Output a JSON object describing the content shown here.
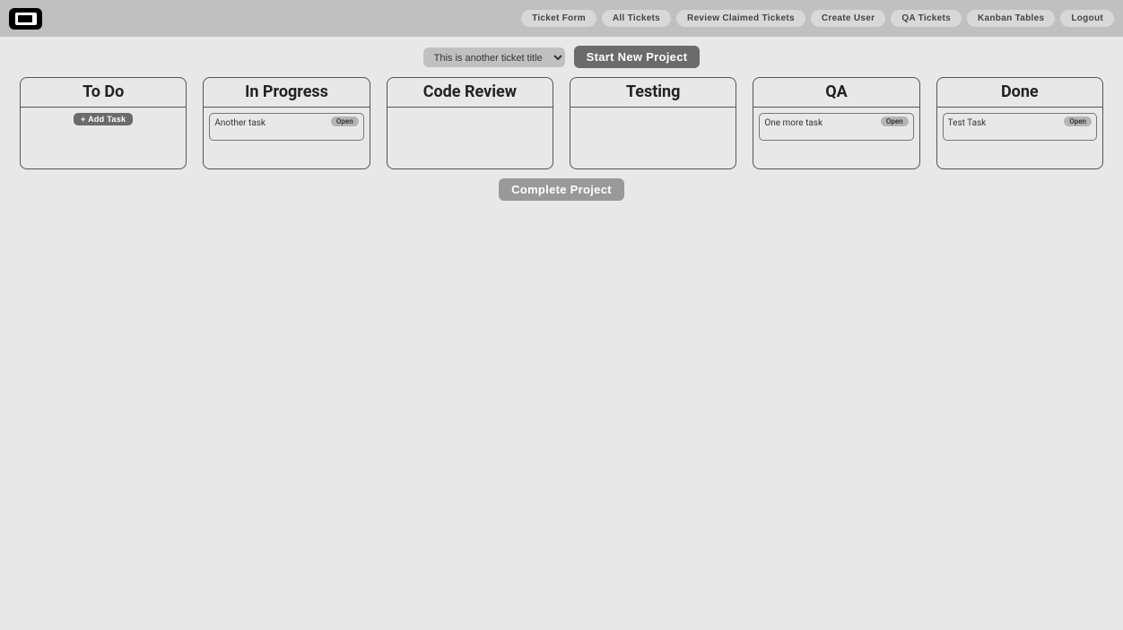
{
  "header": {
    "nav": [
      "Ticket Form",
      "All Tickets",
      "Review Claimed Tickets",
      "Create User",
      "QA Tickets",
      "Kanban Tables",
      "Logout"
    ]
  },
  "toolbar": {
    "project_selected": "This is another ticket title",
    "start_label": "Start New Project"
  },
  "columns": {
    "todo": {
      "title": "To Do",
      "add_label": "+ Add Task"
    },
    "in_progress": {
      "title": "In Progress",
      "cards": [
        {
          "title": "Another task",
          "badge": "Open"
        }
      ]
    },
    "code_review": {
      "title": "Code Review"
    },
    "testing": {
      "title": "Testing"
    },
    "qa": {
      "title": "QA",
      "cards": [
        {
          "title": "One more task",
          "badge": "Open"
        }
      ]
    },
    "done": {
      "title": "Done",
      "cards": [
        {
          "title": "Test Task",
          "badge": "Open"
        }
      ]
    }
  },
  "footer": {
    "complete_label": "Complete Project"
  }
}
